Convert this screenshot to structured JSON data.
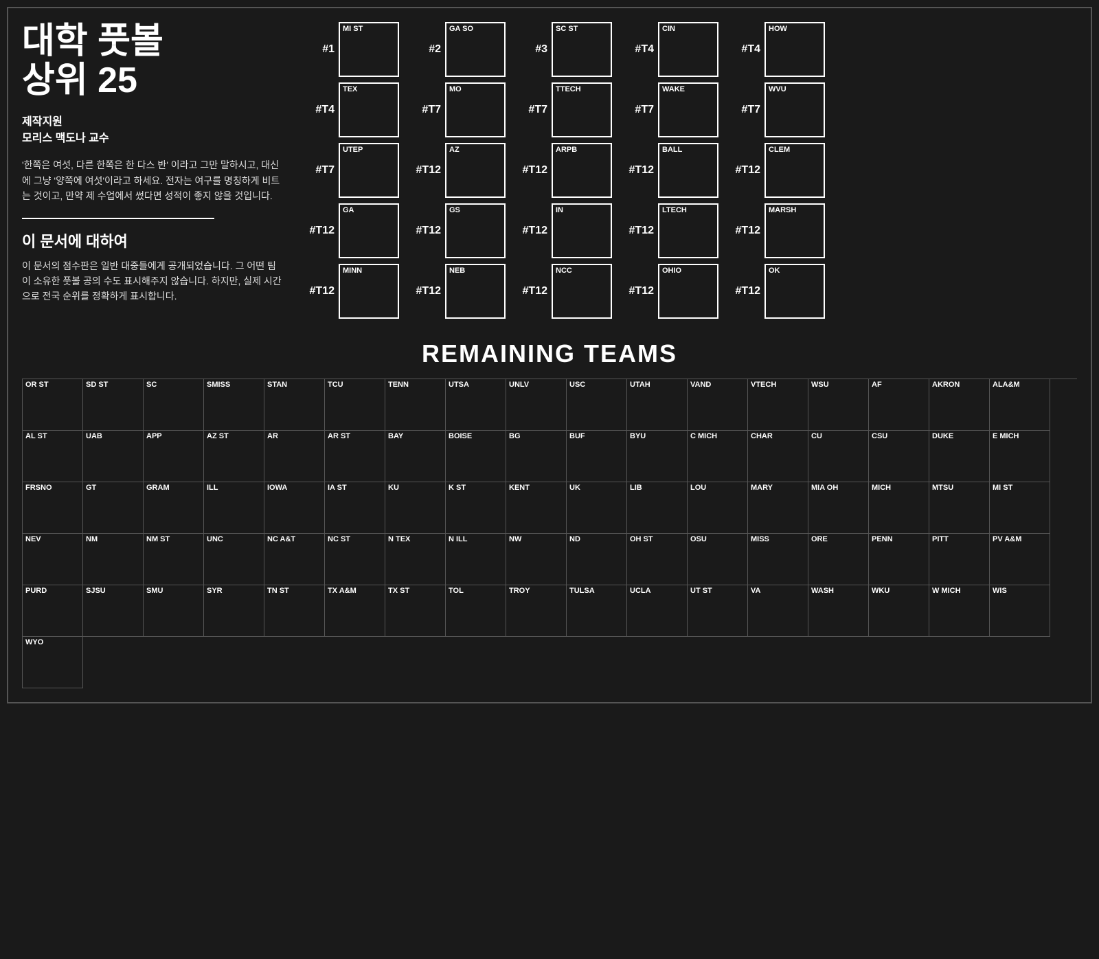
{
  "title": "대학 풋볼\n상위 25",
  "credit_line1": "제작지원",
  "credit_line2": "모리스 맥도나 교수",
  "quote": "'한쪽은 여섯, 다른 한쪽은 한 다스 반' 이라고 그만 말하시고, 대신에 그냥 '양쪽에 여섯'이라고 하세요. 전자는 여구를 명칭하게 비트는 것이고, 만약 제 수업에서 썼다면 성적이 좋지 않을 것입니다.",
  "about_title": "이 문서에 대하여",
  "about_text": "이 문서의 점수판은 일반 대중들에게 공개되었습니다. 그 어떤 팀이 소유한 풋볼 공의 수도 표시해주지 않습니다. 하지만, 실제 시간으로 전국 순위를 정확하게 표시합니다.",
  "remaining_title": "REMAINING TEAMS",
  "rankings": [
    {
      "rank": "#1",
      "teams": [
        {
          "label": "MI ST",
          "rank_display": ""
        },
        {
          "label": "GA SO",
          "rank_display": ""
        },
        {
          "label": "SC ST",
          "rank_display": ""
        },
        {
          "label": "CIN",
          "rank_display": ""
        },
        {
          "label": "HOW",
          "rank_display": ""
        }
      ]
    },
    {
      "rank": "#2",
      "teams": []
    },
    {
      "rank": "#3",
      "teams": []
    },
    {
      "rank": "#T4",
      "teams": []
    },
    {
      "rank": "#T4",
      "teams": []
    }
  ],
  "rank_rows": [
    {
      "rank": "#1",
      "row_teams": [
        {
          "label": "MI ST"
        },
        {
          "label": "GA SO"
        },
        {
          "label": "SC ST"
        },
        {
          "label": "CIN"
        },
        {
          "label": "HOW"
        }
      ],
      "rank_positions": [
        "#1",
        "#2",
        "#3",
        "#T4",
        "#T4"
      ]
    },
    {
      "rank": "#T4",
      "row_teams": [
        {
          "label": "TEX"
        },
        {
          "label": "MO"
        },
        {
          "label": "TTECH"
        },
        {
          "label": "WAKE"
        },
        {
          "label": "WVU"
        }
      ],
      "rank_positions": [
        "#T4",
        "#T7",
        "#T7",
        "#T7",
        "#T7"
      ]
    },
    {
      "rank": "#T7",
      "row_teams": [
        {
          "label": "UTEP"
        },
        {
          "label": "AZ"
        },
        {
          "label": "ARPB"
        },
        {
          "label": "BALL"
        },
        {
          "label": "CLEM"
        }
      ],
      "rank_positions": [
        "#T7",
        "#T12",
        "#T12",
        "#T12",
        "#T12"
      ]
    },
    {
      "rank": "#T12",
      "row_teams": [
        {
          "label": "GA"
        },
        {
          "label": "GS"
        },
        {
          "label": "IN"
        },
        {
          "label": "LTECH"
        },
        {
          "label": "MARSH"
        }
      ],
      "rank_positions": [
        "#T12",
        "#T12",
        "#T12",
        "#T12",
        "#T12"
      ]
    },
    {
      "rank": "#T12",
      "row_teams": [
        {
          "label": "MINN"
        },
        {
          "label": "NEB"
        },
        {
          "label": "NCC"
        },
        {
          "label": "OHIO"
        },
        {
          "label": "OK"
        }
      ],
      "rank_positions": [
        "#T12",
        "#T12",
        "#T12",
        "#T12",
        "#T12"
      ]
    }
  ],
  "remaining_teams": [
    "OR ST",
    "SD ST",
    "SC",
    "SMISS",
    "STAN",
    "TCU",
    "TENN",
    "UTSA",
    "UNLV",
    "USC",
    "UTAH",
    "VAND",
    "VTECH",
    "WSU",
    "AF",
    "AKRON",
    "ALA&M",
    "AL ST",
    "UAB",
    "APP",
    "AZ ST",
    "AR",
    "AR ST",
    "BAY",
    "BOISE",
    "BG",
    "BUF",
    "BYU",
    "C MICH",
    "CHAR",
    "CU",
    "CSU",
    "DUKE",
    "E MICH",
    "FRSNO",
    "GT",
    "GRAM",
    "ILL",
    "IOWA",
    "IA ST",
    "KU",
    "K ST",
    "KENT",
    "UK",
    "LIB",
    "LOU",
    "MARY",
    "MIA OH",
    "MICH",
    "MTSU",
    "MI ST",
    "NEV",
    "NM",
    "NM ST",
    "UNC",
    "NC A&T",
    "NC ST",
    "N TEX",
    "N ILL",
    "NW",
    "ND",
    "OH ST",
    "OSU",
    "MISS",
    "ORE",
    "PENN",
    "PITT",
    "PV A&M",
    "PURD",
    "SJSU",
    "SMU",
    "SYR",
    "TN ST",
    "TX A&M",
    "TX ST",
    "TOL",
    "TROY",
    "TULSA",
    "UCLA",
    "UT ST",
    "VA",
    "WASH",
    "WKU",
    "W MICH",
    "WIS",
    "WYO"
  ]
}
